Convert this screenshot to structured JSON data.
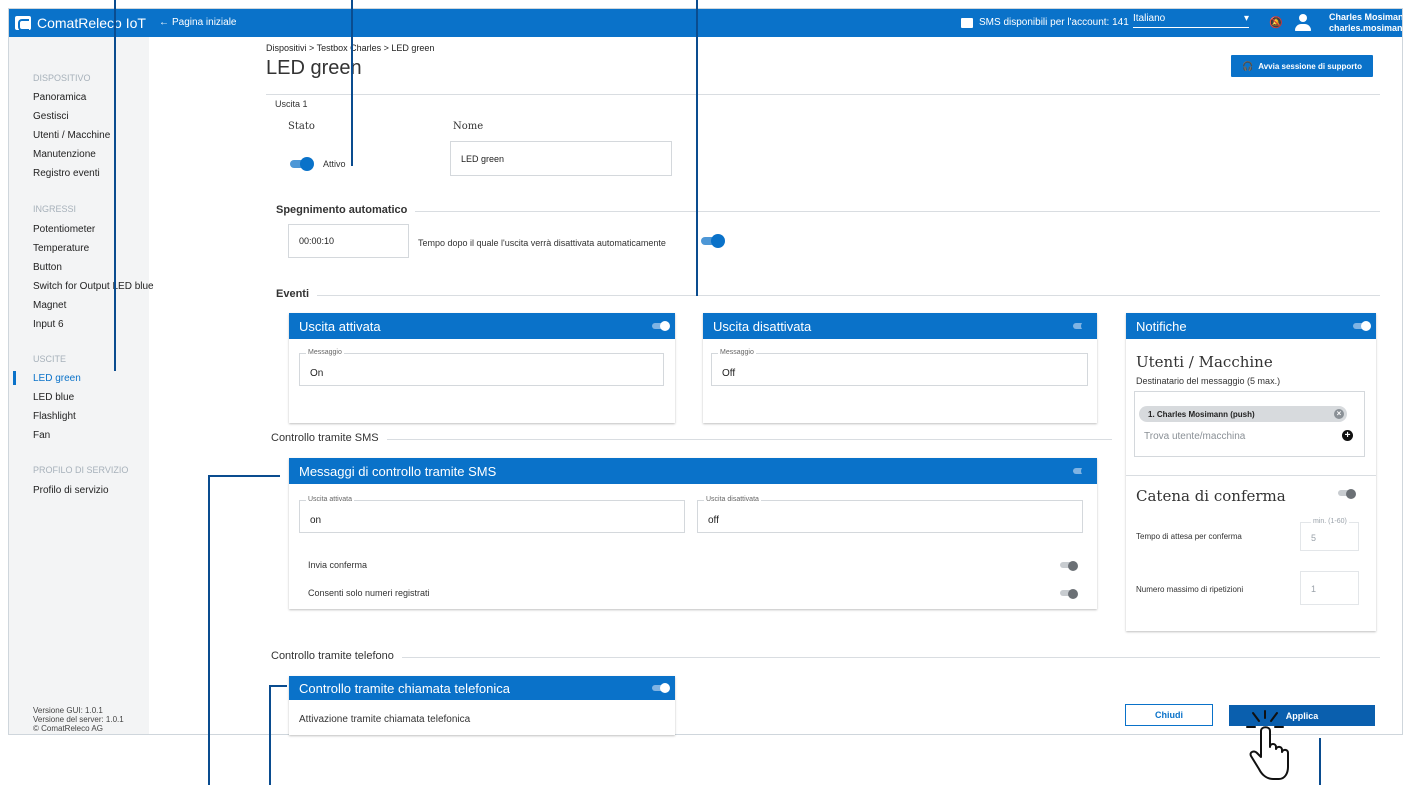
{
  "topbar": {
    "logo": "ComatReleco IoT",
    "back_arrow": "←",
    "back": "Pagina iniziale",
    "sms": "SMS disponibili per l'account: 141",
    "language": "Italiano",
    "language_caret": "▾",
    "bell": "🔕",
    "user_name": "Charles Mosimann",
    "user_login": "charles.mosimann"
  },
  "sidebar": {
    "sections": {
      "dispositivo": "DISPOSITIVO",
      "ingressi": "INGRESSI",
      "uscite": "USCITE",
      "profilo": "PROFILO DI SERVIZIO"
    },
    "dispositivo_items": [
      "Panoramica",
      "Gestisci",
      "Utenti / Macchine",
      "Manutenzione",
      "Registro eventi"
    ],
    "ingressi_items": [
      "Potentiometer",
      "Temperature",
      "Button",
      "Switch for Output LED blue",
      "Magnet",
      "Input 6"
    ],
    "uscite_items": [
      "LED green",
      "LED blue",
      "Flashlight",
      "Fan"
    ],
    "profilo_items": [
      "Profilo di servizio"
    ],
    "footer": [
      "Versione GUI: 1.0.1",
      "Versione del server: 1.0.1",
      "© ComatReleco AG"
    ]
  },
  "main": {
    "breadcrumb": "Dispositivi > Testbox Charles > LED green",
    "title": "LED green",
    "support_button": "Avvia sessione di supporto",
    "support_icon": "🎧",
    "subtitle": "Uscita 1",
    "state_label": "Stato",
    "state_value": "Attivo",
    "name_label": "Nome",
    "name_value": "LED green",
    "auto_off": {
      "heading": "Spegnimento automatico",
      "time": "00:00:10",
      "description": "Tempo dopo il quale l'uscita verrà disattivata automaticamente"
    },
    "events": {
      "heading": "Eventi",
      "on_card": {
        "title": "Uscita attivata",
        "legend": "Messaggio",
        "value": "On"
      },
      "off_card": {
        "title": "Uscita disattivata",
        "legend": "Messaggio",
        "value": "Off"
      }
    },
    "notifications": {
      "title": "Notifiche",
      "users_heading": "Utenti / Macchine",
      "recipients_label": "Destinatario del messaggio (5 max.)",
      "chip": "1. Charles Mosimann  (push)",
      "chip_remove": "×",
      "search_placeholder": "Trova utente/macchina",
      "add": "+",
      "chain_heading": "Catena di conferma",
      "wait_label": "Tempo di attesa per conferma",
      "wait_legend": "min. (1-60)",
      "wait_value": "5",
      "repeat_label": "Numero massimo di ripetizioni",
      "repeat_value": "1"
    },
    "sms_control": {
      "heading": "Controllo tramite SMS",
      "card_title": "Messaggi di controllo tramite SMS",
      "on_legend": "Uscita attivata",
      "on_value": "on",
      "off_legend": "Uscita disattivata",
      "off_value": "off",
      "send_confirm": "Invia conferma",
      "registered_only": "Consenti solo numeri registrati"
    },
    "phone_control": {
      "heading": "Controllo tramite telefono",
      "card_title": "Controllo tramite chiamata telefonica",
      "activation": "Attivazione tramite chiamata telefonica"
    },
    "close_button": "Chiudi",
    "apply_button": "Applica"
  },
  "colors": {
    "primary": "#0a72c9",
    "sidebar_bg": "#f3f4f5",
    "callout": "#0a4c8f"
  }
}
